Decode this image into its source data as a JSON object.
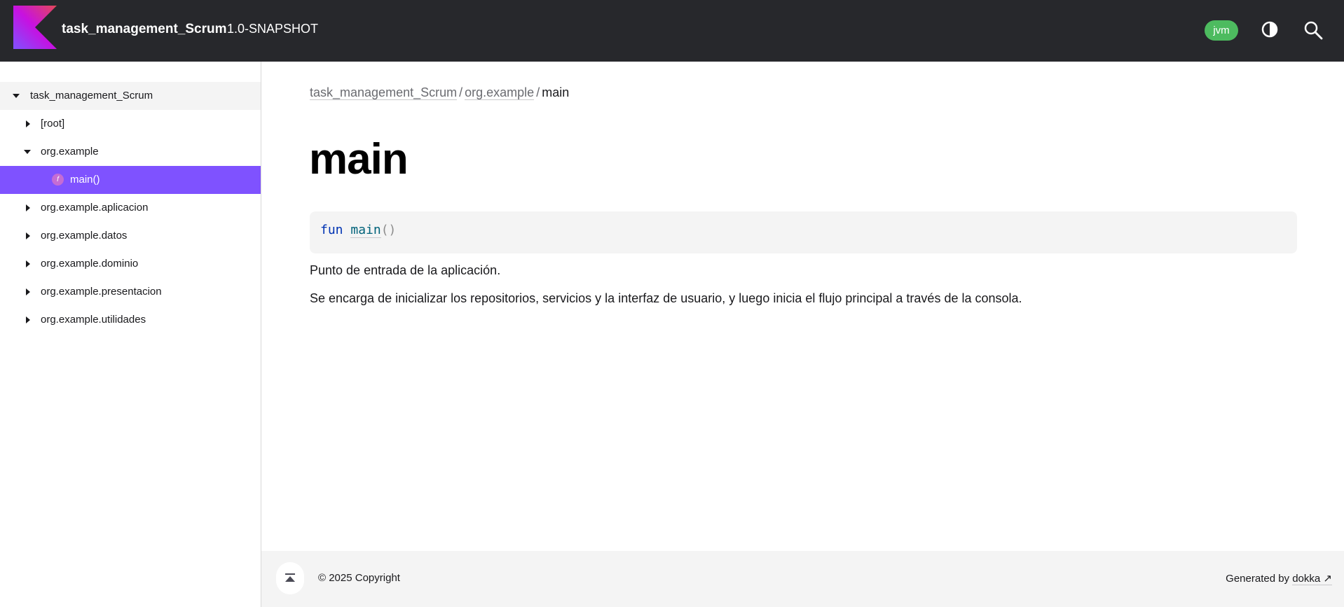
{
  "header": {
    "project_name": "task_management_Scrum",
    "version": "1.0-SNAPSHOT",
    "platform_badge": "jvm",
    "icons": [
      "kotlin-logo",
      "theme-toggle-icon",
      "search-icon"
    ],
    "colors": {
      "header_bg": "#27282c",
      "badge": "#4dbb5f",
      "accent": "#7f52ff"
    }
  },
  "sidebar": {
    "root": {
      "label": "task_management_Scrum",
      "expanded": true
    },
    "items": [
      {
        "label": "[root]",
        "expanded": false
      },
      {
        "label": "org.example",
        "expanded": true
      },
      {
        "label": "main()",
        "selected": true,
        "icon": "function-icon",
        "icon_letter": "f"
      },
      {
        "label": "org.example.aplicacion",
        "expanded": false
      },
      {
        "label": "org.example.datos",
        "expanded": false
      },
      {
        "label": "org.example.dominio",
        "expanded": false
      },
      {
        "label": "org.example.presentacion",
        "expanded": false
      },
      {
        "label": "org.example.utilidades",
        "expanded": false
      }
    ]
  },
  "main": {
    "breadcrumb": [
      {
        "label": "task_management_Scrum"
      },
      {
        "label": "org.example"
      },
      {
        "label": "main"
      }
    ],
    "breadcrumb_separator": "/",
    "title": "main",
    "signature": {
      "keyword": "fun",
      "name": "main",
      "params": "()"
    },
    "description": [
      "Punto de entrada de la aplicación.",
      "Se encarga de inicializar los repositorios, servicios y la interfaz de usuario, y luego inicia el flujo principal a través de la consola."
    ]
  },
  "footer": {
    "copyright": "© 2025 Copyright",
    "generated_prefix": "Generated by ",
    "generated_link": "dokka",
    "link_arrow": "↗"
  }
}
